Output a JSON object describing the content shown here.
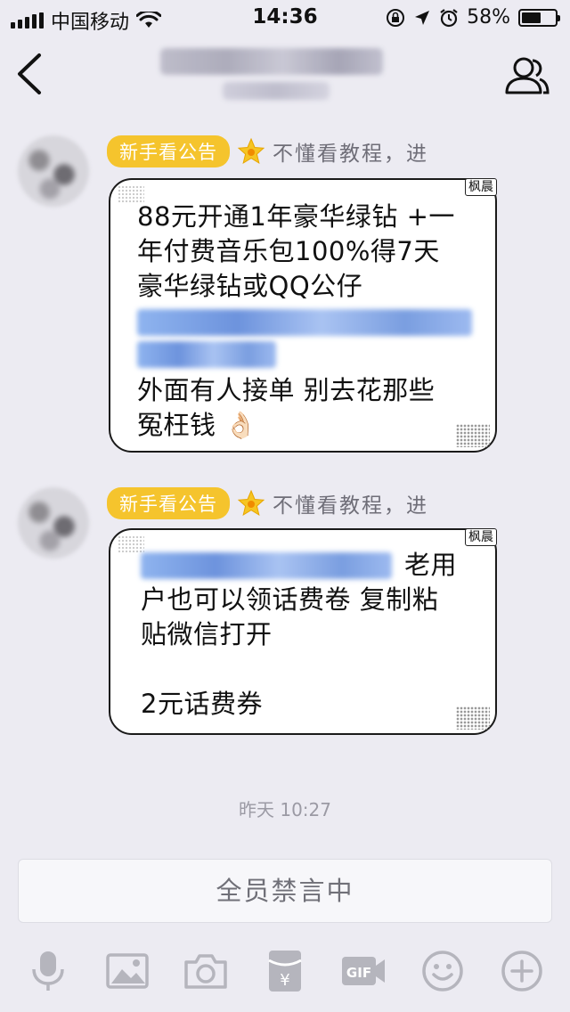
{
  "status_bar": {
    "carrier": "中国移动",
    "time": "14:36",
    "battery": "58%",
    "battery_level": 0.58
  },
  "nav": {
    "back_icon": "chevron-left-icon",
    "profile_icon": "group-members-icon"
  },
  "messages": [
    {
      "badge": "新手看公告",
      "nickname": "不懂看教程，进",
      "tag": "枫晨",
      "lines": [
        "88元开通1年豪华绿钻 +一",
        "年付费音乐包100%得7天",
        "豪华绿钻或QQ公仔"
      ],
      "after_link": [
        "外面有人接单 别去花那些",
        "冤枉钱 👌🏻"
      ]
    },
    {
      "badge": "新手看公告",
      "nickname": "不懂看教程，进",
      "tag": "枫晨",
      "first_line_tail": "老用",
      "lines": [
        "户也可以领话费卷 复制粘",
        "贴微信打开"
      ],
      "last_line": "2元话费券"
    }
  ],
  "timestamp": "昨天 10:27",
  "input": {
    "placeholder": "全员禁言中"
  },
  "toolbar": {
    "icons": [
      "microphone-icon",
      "image-icon",
      "camera-icon",
      "red-packet-icon",
      "gif-icon",
      "emoji-icon",
      "plus-icon"
    ]
  },
  "colors": {
    "background": "#ecebf2",
    "badge": "#f5c42d",
    "bubble_border": "#1a1a1a"
  }
}
